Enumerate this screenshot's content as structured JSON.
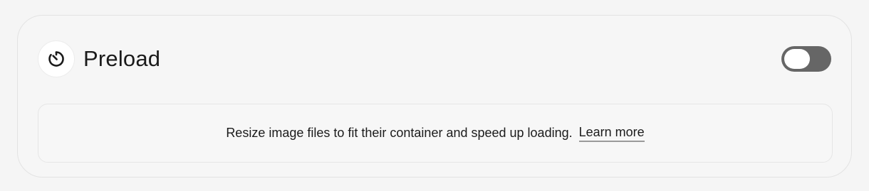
{
  "section": {
    "title": "Preload",
    "icon": "timer-icon",
    "toggle": {
      "state": "off",
      "track_color": "#666666"
    }
  },
  "description": {
    "text": "Resize image files to fit their container and speed up loading.",
    "link_label": "Learn more"
  }
}
